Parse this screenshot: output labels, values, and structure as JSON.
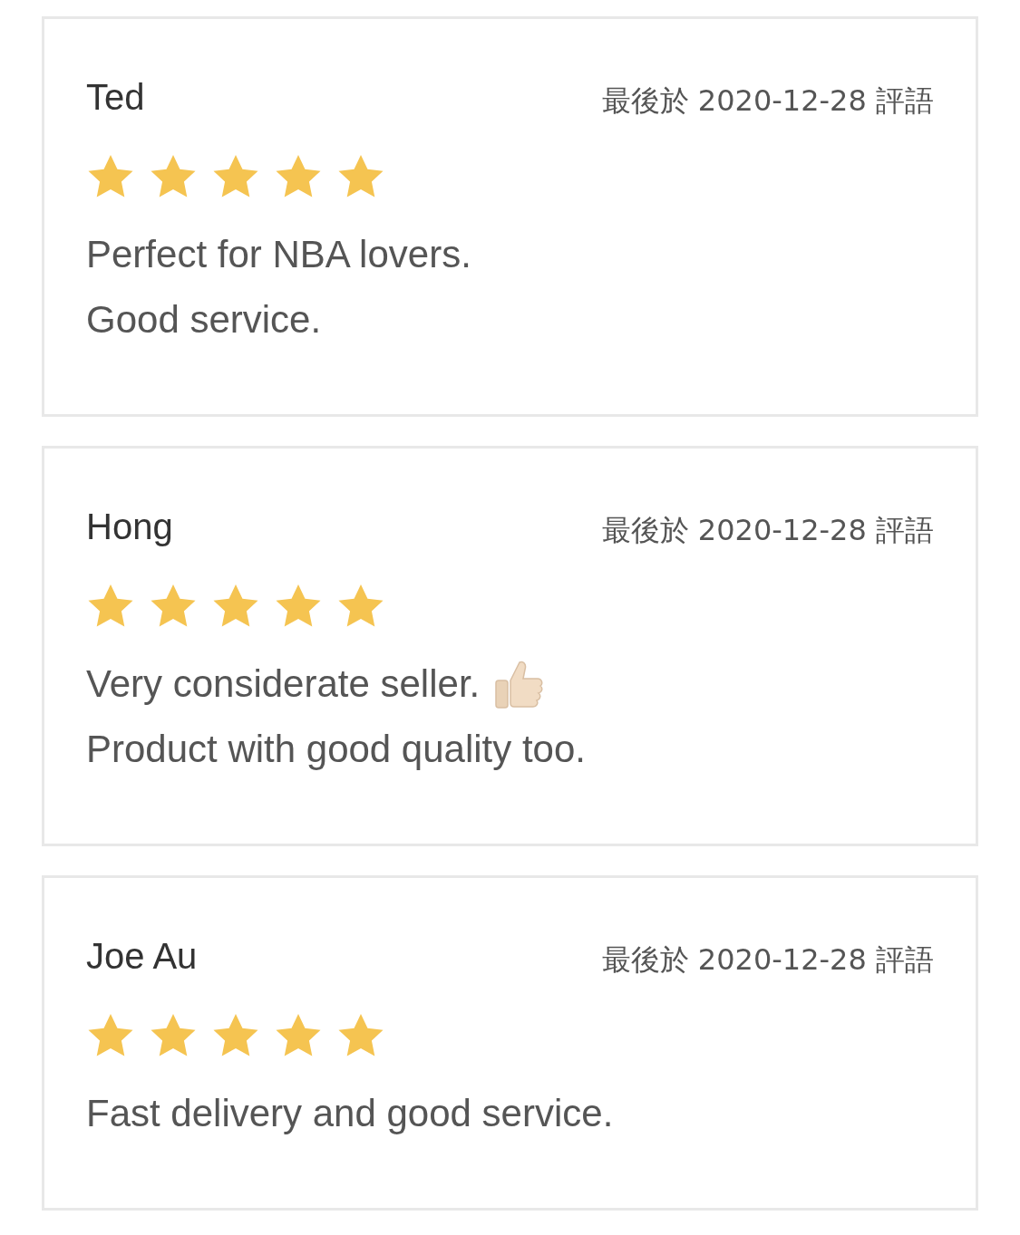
{
  "reviews": [
    {
      "name": "Ted",
      "date": "最後於 2020-12-28 評語",
      "stars": 5,
      "lines": [
        {
          "text": "Perfect for NBA lovers.",
          "thumbs_up": false
        },
        {
          "text": "Good service.",
          "thumbs_up": false
        }
      ]
    },
    {
      "name": "Hong",
      "date": "最後於 2020-12-28 評語",
      "stars": 5,
      "lines": [
        {
          "text": "Very considerate seller.",
          "thumbs_up": true
        },
        {
          "text": "Product with good quality too.",
          "thumbs_up": false
        }
      ]
    },
    {
      "name": "Joe Au",
      "date": "最後於 2020-12-28 評語",
      "stars": 5,
      "lines": [
        {
          "text": "Fast delivery and good service.",
          "thumbs_up": false
        }
      ]
    }
  ]
}
